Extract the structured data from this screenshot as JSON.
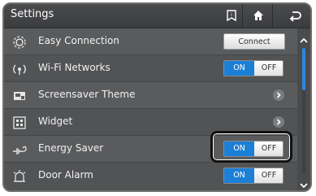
{
  "header": {
    "title": "Settings",
    "icons": [
      "manual-icon",
      "home-icon",
      "back-icon"
    ]
  },
  "rows": [
    {
      "label": "Easy Connection",
      "icon": "easy-connection-icon",
      "control": "button",
      "button_label": "Connect"
    },
    {
      "label": "Wi-Fi Networks",
      "icon": "wifi-icon",
      "control": "toggle",
      "on_label": "ON",
      "off_label": "OFF",
      "state": "on"
    },
    {
      "label": "Screensaver Theme",
      "icon": "screensaver-icon",
      "control": "chevron"
    },
    {
      "label": "Widget",
      "icon": "widget-icon",
      "control": "chevron"
    },
    {
      "label": "Energy Saver",
      "icon": "energy-saver-icon",
      "control": "toggle",
      "on_label": "ON",
      "off_label": "OFF",
      "state": "on",
      "highlighted": true
    },
    {
      "label": "Door Alarm",
      "icon": "door-alarm-icon",
      "control": "toggle",
      "on_label": "ON",
      "off_label": "OFF",
      "state": "on"
    }
  ],
  "scrollbar": {
    "position": 0.0
  },
  "colors": {
    "accent": "#1c7fd6",
    "panel": "#58595b",
    "header": "#3b3c3e"
  }
}
